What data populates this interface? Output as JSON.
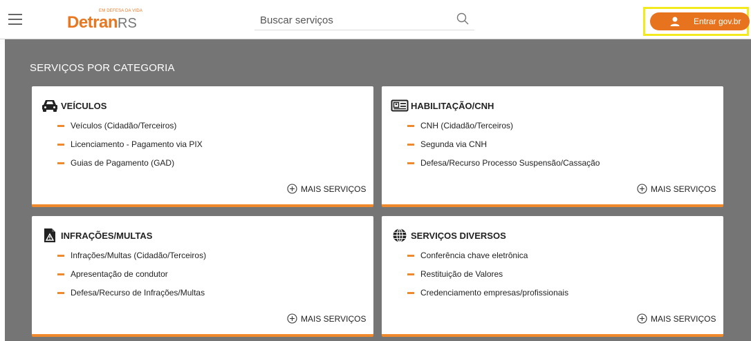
{
  "header": {
    "menu_icon": "hamburger-menu-icon",
    "logo": {
      "tagline": "EM DEFESA DA VIDA",
      "brand": "Detran",
      "suffix": "RS"
    },
    "search": {
      "placeholder": "Buscar serviços",
      "icon": "search-icon"
    },
    "login": {
      "label": "Entrar gov.br",
      "icon": "user-icon"
    }
  },
  "main": {
    "section_title": "SERVIÇOS POR CATEGORIA",
    "cards": [
      {
        "title": "VEÍCULOS",
        "icon": "car-icon",
        "items": [
          "Veículos (Cidadão/Terceiros)",
          "Licenciamento - Pagamento via PIX",
          "Guias de Pagamento (GAD)"
        ],
        "more": "MAIS SERVIÇOS"
      },
      {
        "title": "HABILITAÇÃO/CNH",
        "icon": "id-card-icon",
        "items": [
          "CNH (Cidadão/Terceiros)",
          "Segunda via CNH",
          "Defesa/Recurso Processo Suspensão/Cassação"
        ],
        "more": "MAIS SERVIÇOS"
      },
      {
        "title": "INFRAÇÕES/MULTAS",
        "icon": "warning-document-icon",
        "items": [
          "Infrações/Multas (Cidadão/Terceiros)",
          "Apresentação de condutor",
          "Defesa/Recurso de Infrações/Multas"
        ],
        "more": "MAIS SERVIÇOS"
      },
      {
        "title": "SERVIÇOS DIVERSOS",
        "icon": "globe-icon",
        "items": [
          "Conferência chave eletrônica",
          "Restituição de Valores",
          "Credenciamento empresas/profissionais"
        ],
        "more": "MAIS SERVIÇOS"
      }
    ]
  },
  "colors": {
    "accent": "#e8731f",
    "card_border": "#f0882c",
    "background": "#757575",
    "highlight": "#f3ea1e"
  }
}
